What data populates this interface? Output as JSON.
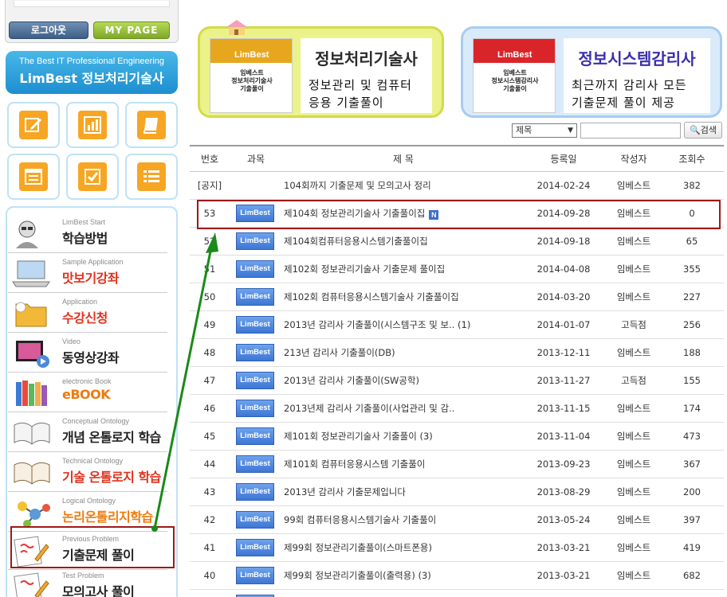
{
  "sidebar": {
    "logout_label": "로그아웃",
    "mypage_label": "MY PAGE",
    "banner": {
      "line1": "The Best IT Professional Engineering",
      "line2": "LimBest 정보처리기술사"
    },
    "icon_buttons": [
      "pencil-icon",
      "bar-chart-icon",
      "book-icon",
      "list-card-icon",
      "checkbox-icon",
      "bullet-list-icon"
    ],
    "menu": [
      {
        "en": "LimBest Start",
        "ko": "학습방법",
        "style": "dark"
      },
      {
        "en": "Sample Application",
        "ko": "맛보기강좌",
        "style": "red"
      },
      {
        "en": "Application",
        "ko": "수강신청",
        "style": "red"
      },
      {
        "en": "Video",
        "ko": "동영상강좌",
        "style": "dark"
      },
      {
        "en": "electronic Book",
        "ko": "eBOOK",
        "style": "orange"
      },
      {
        "en": "Conceptual Ontology",
        "ko": "개념 온톨로지 학습",
        "style": "dark"
      },
      {
        "en": "Technical Ontology",
        "ko": "기술 온톨로지 학습",
        "style": "red"
      },
      {
        "en": "Logical Ontology",
        "ko": "논리온톨리지학습",
        "style": "orange"
      },
      {
        "en": "Previous Problem",
        "ko": "기출문제 풀이",
        "style": "dark"
      },
      {
        "en": "Test Problem",
        "ko": "모의고사 풀이",
        "style": "dark"
      }
    ]
  },
  "banners": [
    {
      "book_brand": "LimBest",
      "book_title": "임베스트\n정보처리기술사\n기출풀이",
      "title": "정보처리기술사",
      "desc_line1": "정보관리 및 컴퓨터",
      "desc_line2": "응용 기출풀이"
    },
    {
      "book_brand": "LimBest",
      "book_title": "임베스트\n정보시스템감리사\n기출풀이",
      "title": "정보시스템감리사",
      "desc_line1": "최근까지 감리사 모든",
      "desc_line2": "기출문제 풀이 제공"
    }
  ],
  "search": {
    "select_value": "제목",
    "button_label": "검색"
  },
  "board": {
    "headers": {
      "no": "번호",
      "category": "과목",
      "title": "제 목",
      "date": "등록일",
      "writer": "작성자",
      "views": "조회수"
    },
    "badge_label": "LimBest",
    "new_label": "N",
    "rows": [
      {
        "no": "[공지]",
        "title": "104회까지 기출문제 및 모의고사 정리",
        "date": "2014-02-24",
        "writer": "임베스트",
        "views": "382",
        "badge": false,
        "new": false
      },
      {
        "no": "53",
        "title": "제104회 정보관리기술사 기출풀이집",
        "date": "2014-09-28",
        "writer": "임베스트",
        "views": "0",
        "badge": true,
        "new": true
      },
      {
        "no": "52",
        "title": "제104회컴퓨터응용시스템기출풀이집",
        "date": "2014-09-18",
        "writer": "임베스트",
        "views": "65",
        "badge": true,
        "new": false
      },
      {
        "no": "51",
        "title": "제102회 정보관리기술사 기출문제 풀이집",
        "date": "2014-04-08",
        "writer": "임베스트",
        "views": "355",
        "badge": true,
        "new": false
      },
      {
        "no": "50",
        "title": "제102회 컴퓨터응용시스템기술사 기출풀이집",
        "date": "2014-03-20",
        "writer": "임베스트",
        "views": "227",
        "badge": true,
        "new": false
      },
      {
        "no": "49",
        "title": "2013년 감리사 기출풀이(시스템구조 및 보.. (1)",
        "date": "2014-01-07",
        "writer": "고득점",
        "views": "256",
        "badge": true,
        "new": false
      },
      {
        "no": "48",
        "title": "213년 감리사 기출풀이(DB)",
        "date": "2013-12-11",
        "writer": "임베스트",
        "views": "188",
        "badge": true,
        "new": false
      },
      {
        "no": "47",
        "title": "2013년 감리사 기출풀이(SW공학)",
        "date": "2013-11-27",
        "writer": "고득점",
        "views": "155",
        "badge": true,
        "new": false
      },
      {
        "no": "46",
        "title": "2013년제 감리사 기출풀이(사업관리 및 감..",
        "date": "2013-11-15",
        "writer": "임베스트",
        "views": "174",
        "badge": true,
        "new": false
      },
      {
        "no": "45",
        "title": "제101회 정보관리기술사 기출풀이 (3)",
        "date": "2013-11-04",
        "writer": "임베스트",
        "views": "473",
        "badge": true,
        "new": false
      },
      {
        "no": "44",
        "title": "제101회 컴퓨터응용시스템 기출풀이",
        "date": "2013-09-23",
        "writer": "임베스트",
        "views": "367",
        "badge": true,
        "new": false
      },
      {
        "no": "43",
        "title": "2013년 감리사 기출문제입니다",
        "date": "2013-08-29",
        "writer": "임베스트",
        "views": "200",
        "badge": true,
        "new": false
      },
      {
        "no": "42",
        "title": "99회 컴퓨터응용시스템기술사 기출풀이",
        "date": "2013-05-24",
        "writer": "임베스트",
        "views": "397",
        "badge": true,
        "new": false
      },
      {
        "no": "41",
        "title": "제99회 정보관리기출풀이(스마트폰용)",
        "date": "2013-03-21",
        "writer": "임베스트",
        "views": "419",
        "badge": true,
        "new": false
      },
      {
        "no": "40",
        "title": "제99회 정보관리기출풀이(출력용) (3)",
        "date": "2013-03-21",
        "writer": "임베스트",
        "views": "682",
        "badge": true,
        "new": false
      },
      {
        "no": "",
        "title": "",
        "date": "",
        "writer": "",
        "views": "",
        "badge": true,
        "new": false
      }
    ]
  },
  "colors": {
    "highlight": "#a01818",
    "arrow": "#1a8a1a",
    "accent_blue": "#3d76d4"
  }
}
